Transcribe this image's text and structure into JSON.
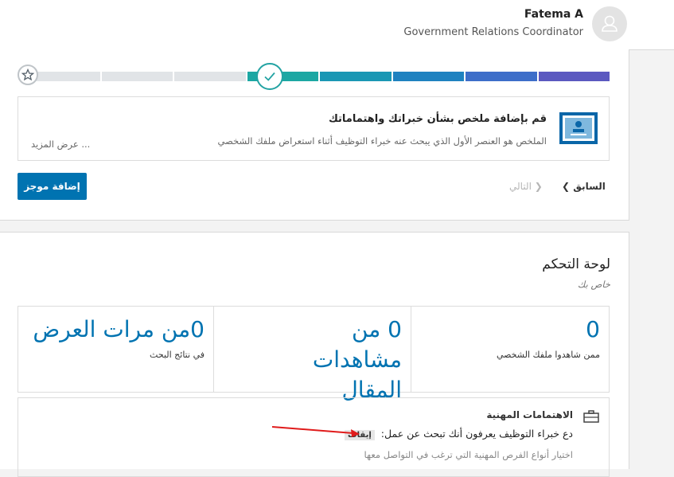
{
  "header": {
    "user_name": "Fatema A",
    "user_title": "Government Relations Coordinator",
    "avatar_icon": "person-icon"
  },
  "profile_strength": {
    "start_icon": "star-icon",
    "current_icon": "check-icon",
    "segment_colors": [
      "#e1e4e7",
      "#e1e4e7",
      "#e1e4e7",
      "#1ca7a3",
      "#1a97b4",
      "#1f82c0",
      "#3d6ec9",
      "#5b59c0"
    ]
  },
  "suggestion": {
    "icon": "profile-summary-icon",
    "title": "قم بإضافة ملخص بشأن خبراتك واهتماماتك",
    "description": "الملخص هو العنصر الأول الذي يبحث عنه خبراء التوظيف أثناء استعراض ملفك الشخصي",
    "see_more": "... عرض المزيد",
    "add_button": "إضافة موجز",
    "prev_label": "السابق",
    "next_label": "التالي"
  },
  "dashboard": {
    "title": "لوحة التحكم",
    "subtitle": "خاص بك",
    "stats": [
      {
        "value": "0",
        "label": "ممن شاهدوا ملفك الشخصي"
      },
      {
        "value": "0 من مشاهدات المقال",
        "label": ""
      },
      {
        "value": "0من مرات العرض",
        "label": "في نتائج البحث"
      }
    ],
    "interests": {
      "icon": "briefcase-icon",
      "title": "الاهتمامات المهنية",
      "line": "دع خبراء التوظيف يعرفون أنك تبحث عن عمل:",
      "status_badge": "إيقاف",
      "sub": "اختيار أنواع الفرص المهنية التي ترغب في التواصل معها"
    }
  },
  "accent_color": "#0073b1",
  "annotation_color": "#e01b1b"
}
